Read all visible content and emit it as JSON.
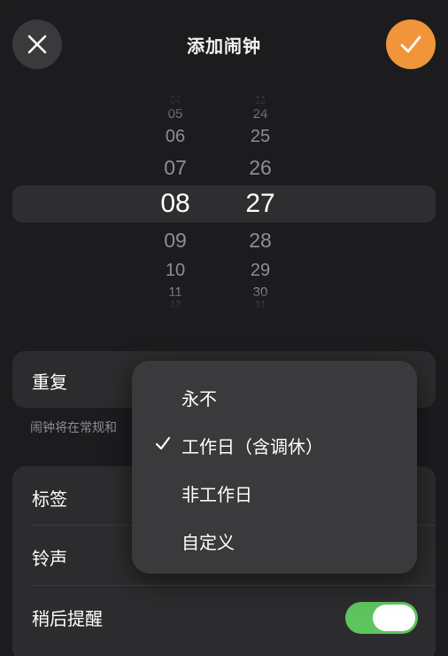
{
  "header": {
    "title": "添加闹钟",
    "close_icon": "close-icon",
    "confirm_icon": "checkmark-icon",
    "accent_color": "#f0953a"
  },
  "time_picker": {
    "hours": {
      "above": [
        "04",
        "05",
        "06",
        "07"
      ],
      "selected": "08",
      "below": [
        "09",
        "10",
        "11",
        "12"
      ]
    },
    "minutes": {
      "above": [
        "23",
        "24",
        "25",
        "26"
      ],
      "selected": "27",
      "below": [
        "28",
        "29",
        "30",
        "31"
      ]
    }
  },
  "repeat": {
    "label": "重复"
  },
  "repeat_note": "闹钟将在常规和",
  "settings": {
    "label_row": "标签",
    "ringtone_row": "铃声",
    "snooze_row": "稍后提醒",
    "snooze_on": true,
    "toggle_color": "#5ec45f"
  },
  "repeat_menu": {
    "items": [
      {
        "label": "永不",
        "checked": false
      },
      {
        "label": "工作日（含调休）",
        "checked": true
      },
      {
        "label": "非工作日",
        "checked": false
      },
      {
        "label": "自定义",
        "checked": false
      }
    ],
    "check_icon": "checkmark-icon"
  }
}
